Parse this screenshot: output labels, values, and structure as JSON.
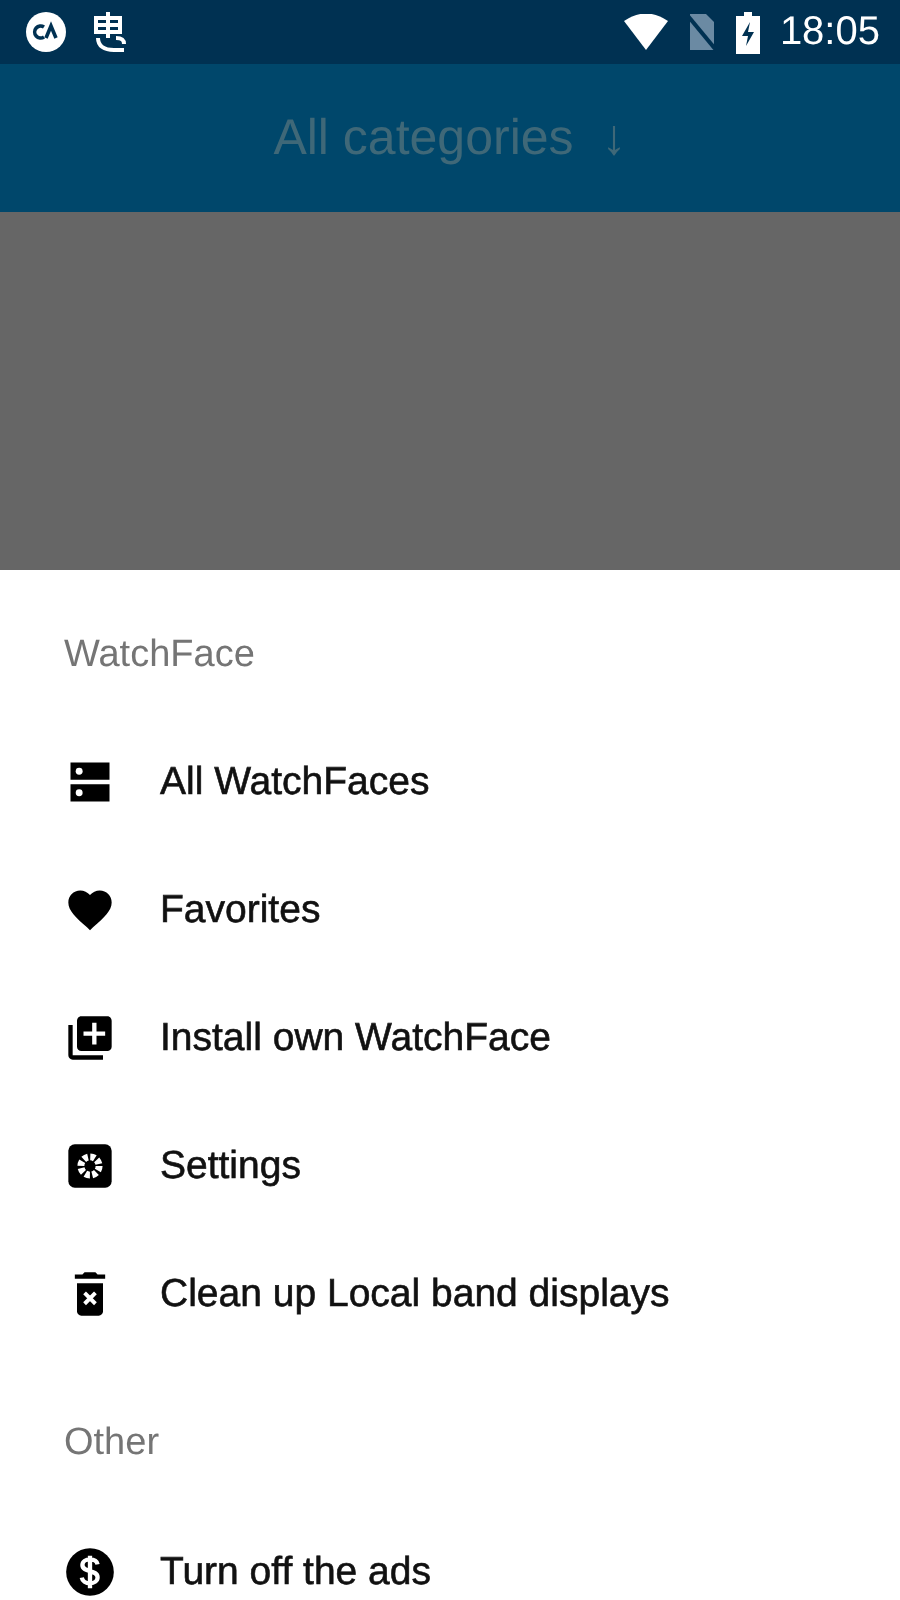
{
  "status_bar": {
    "time": "18:05"
  },
  "toolbar": {
    "title": "All categories",
    "arrow": "↓"
  },
  "sections": [
    {
      "header": "WatchFace",
      "items": [
        {
          "label": "All WatchFaces",
          "kind": "list"
        },
        {
          "label": "Favorites",
          "kind": "heart"
        },
        {
          "label": "Install own WatchFace",
          "kind": "add"
        },
        {
          "label": "Settings",
          "kind": "gear"
        },
        {
          "label": "Clean up Local band displays",
          "kind": "trash"
        }
      ]
    },
    {
      "header": "Other",
      "items": [
        {
          "label": "Turn off the ads",
          "kind": "dollar"
        }
      ]
    }
  ]
}
